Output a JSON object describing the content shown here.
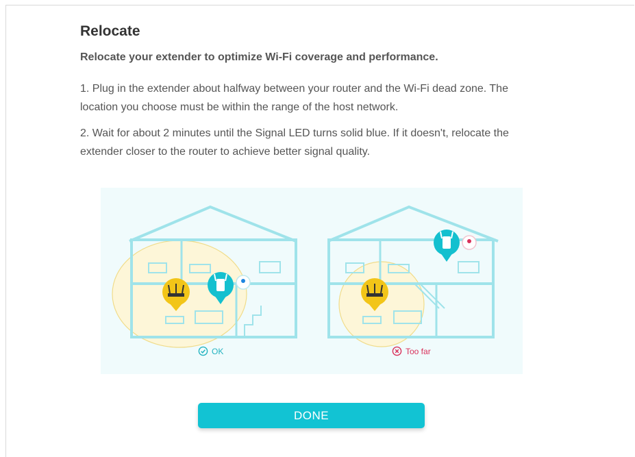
{
  "page": {
    "title": "Relocate",
    "subtitle": "Relocate your extender to optimize Wi-Fi coverage and performance.",
    "step1": "1. Plug in the extender about halfway between your router and the Wi-Fi dead zone. The location you choose must be within the range of the host network.",
    "step2": "2. Wait for about 2 minutes until the Signal LED turns solid blue. If it doesn't, relocate the extender closer to the router to achieve better signal quality."
  },
  "illustration": {
    "ok_label": "OK",
    "too_far_label": "Too far"
  },
  "actions": {
    "done_label": "DONE"
  },
  "colors": {
    "accent": "#12c3d3",
    "ok": "#23b3c0",
    "error": "#d9305a",
    "router": "#f2c518",
    "coverage": "#fdf6d8"
  }
}
